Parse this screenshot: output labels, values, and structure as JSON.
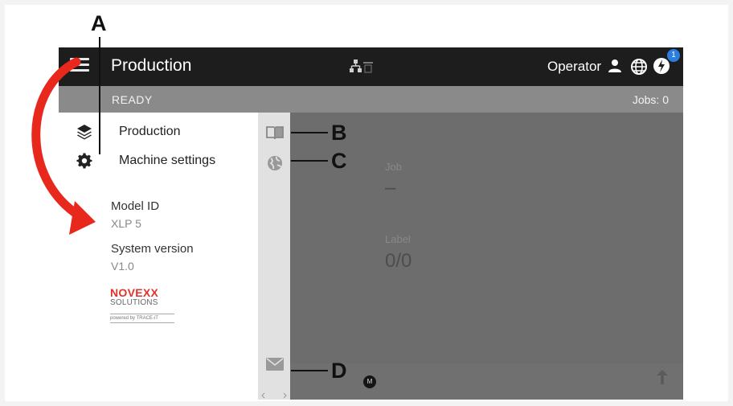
{
  "header": {
    "title": "Production",
    "user_label": "Operator",
    "notification_count": "1"
  },
  "status": {
    "state": "READY",
    "jobs": "Jobs: 0"
  },
  "drawer": {
    "items": [
      {
        "label": "Production",
        "icon": "layers-icon"
      },
      {
        "label": "Machine settings",
        "icon": "gear-icon"
      }
    ],
    "model_id_label": "Model ID",
    "model_id_value": "XLP 5",
    "system_version_label": "System version",
    "system_version_value": "V1.0",
    "logo_brand": "NOVEXX",
    "logo_sub": "SOLUTIONS",
    "logo_powered": "powered by TRACE-iT"
  },
  "main": {
    "job_label": "Job",
    "job_value": "–",
    "label_label": "Label",
    "label_value": "0/0",
    "round_button": "M"
  },
  "callouts": {
    "a": "A",
    "b": "B",
    "c": "C",
    "d": "D"
  },
  "colors": {
    "topbar": "#1d1d1d",
    "statusbar": "#8a8a8a",
    "overlay": "#6b6b6b",
    "arrow": "#e8281c",
    "badge": "#2a7de1",
    "brand": "#e0332c"
  }
}
